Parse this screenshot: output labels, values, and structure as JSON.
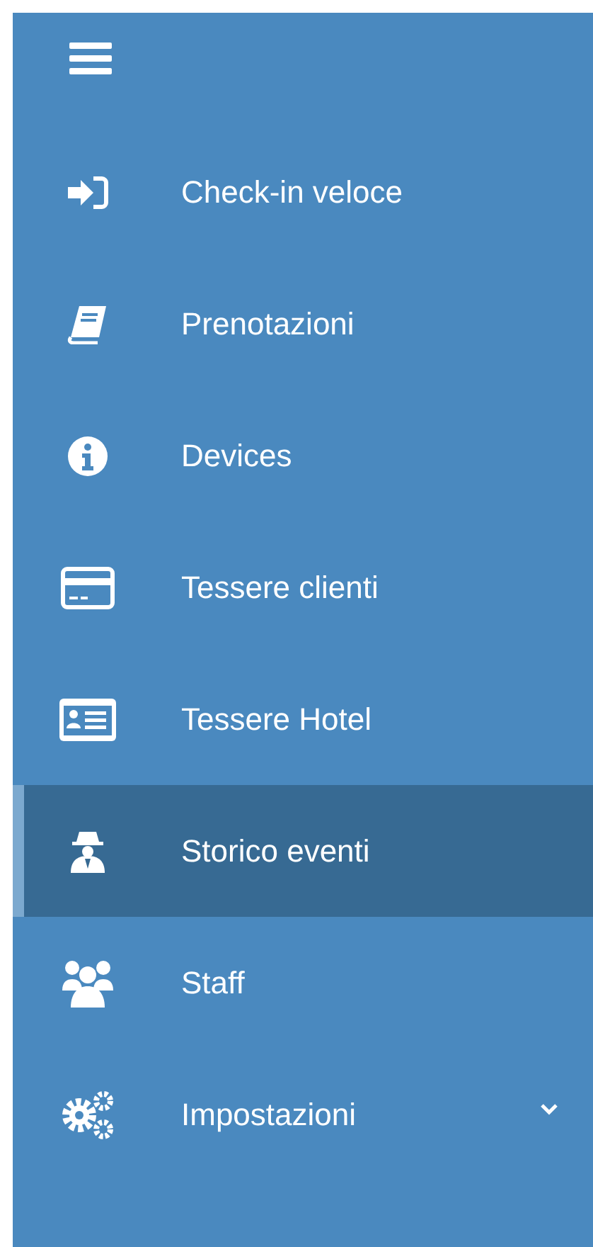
{
  "menu_items": [
    {
      "label": "Check-in veloce",
      "selected": false,
      "expandable": false
    },
    {
      "label": "Prenotazioni",
      "selected": false,
      "expandable": false
    },
    {
      "label": "Devices",
      "selected": false,
      "expandable": false
    },
    {
      "label": "Tessere clienti",
      "selected": false,
      "expandable": false
    },
    {
      "label": "Tessere Hotel",
      "selected": false,
      "expandable": false
    },
    {
      "label": "Storico eventi",
      "selected": true,
      "expandable": false
    },
    {
      "label": "Staff",
      "selected": false,
      "expandable": false
    },
    {
      "label": "Impostazioni",
      "selected": false,
      "expandable": true
    }
  ]
}
